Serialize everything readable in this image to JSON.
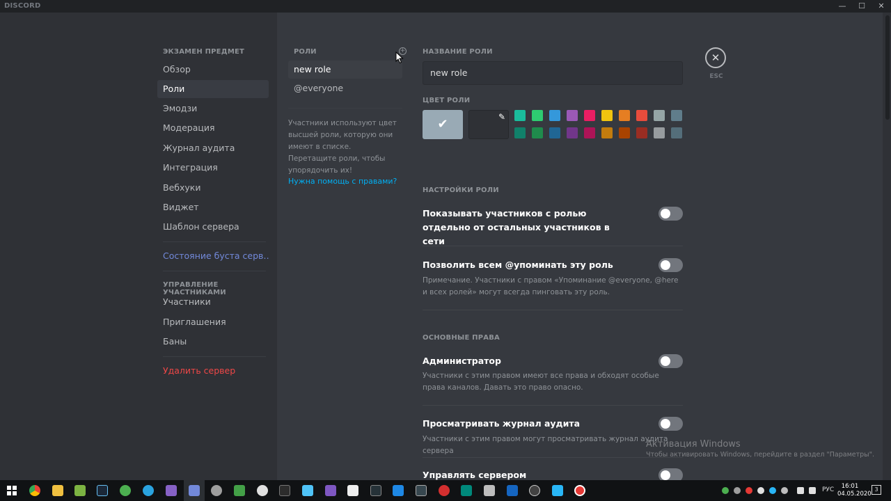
{
  "titlebar": {
    "app": "DISCORD",
    "minimize": "—",
    "maximize": "☐",
    "close": "✕"
  },
  "nav": {
    "header": "ЭКЗАМЕН ПРЕДМЕТ",
    "items": [
      "Обзор",
      "Роли",
      "Эмодзи",
      "Модерация",
      "Журнал аудита",
      "Интеграция",
      "Вебхуки",
      "Виджет",
      "Шаблон сервера"
    ],
    "boost": "Состояние буста серв…",
    "members_header": "УПРАВЛЕНИЕ УЧАСТНИКАМИ",
    "members_items": [
      "Участники",
      "Приглашения",
      "Баны"
    ],
    "delete": "Удалить сервер"
  },
  "roles": {
    "header": "РОЛИ",
    "add_icon": "plus-circle-icon",
    "items": [
      "new role",
      "@everyone"
    ],
    "help": "Участники используют цвет высшей роли, которую они имеют в списке. Перетащите роли, чтобы упорядочить их!",
    "link": "Нужна помощь с правами?"
  },
  "settings": {
    "name_title": "НАЗВАНИЕ РОЛИ",
    "name_value": "new role",
    "color_title": "ЦВЕТ РОЛИ",
    "default_color": "#99aab5",
    "colors_top": [
      "#1abc9c",
      "#2ecc71",
      "#3498db",
      "#9b59b6",
      "#e91e63",
      "#f1c40f",
      "#e67e22",
      "#e74c3c",
      "#95a5a6",
      "#607d8b"
    ],
    "colors_bottom": [
      "#11806a",
      "#1f8b4c",
      "#206694",
      "#71368a",
      "#ad1457",
      "#c27c0e",
      "#a84300",
      "#992d22",
      "#979c9f",
      "#546e7a"
    ],
    "role_settings_title": "НАСТРОЙКИ РОЛИ",
    "hoist_title": "Показывать участников с ролью отдельно от остальных участников в сети",
    "mention_title": "Позволить всем @упоминать эту роль",
    "mention_desc": "Примечание. Участники с правом «Упоминание @everyone, @here и всех ролей» могут всегда пинговать эту роль.",
    "basic_title": "ОСНОВНЫЕ ПРАВА",
    "admin_title": "Администратор",
    "admin_desc": "Участники с этим правом имеют все права и обходят особые права каналов. Давать это право опасно.",
    "audit_title": "Просматривать журнал аудита",
    "audit_desc": "Участники с этим правом могут просматривать журнал аудита сервера",
    "manage_title": "Управлять сервером"
  },
  "close": {
    "icon": "close-icon",
    "label": "ESC"
  },
  "watermark": {
    "title": "Активация Windows",
    "text": "Чтобы активировать Windows, перейдите в раздел \"Параметры\"."
  },
  "taskbar": {
    "lang": "РУС",
    "time": "16:01",
    "date": "04.05.2020",
    "notifications": "3"
  }
}
